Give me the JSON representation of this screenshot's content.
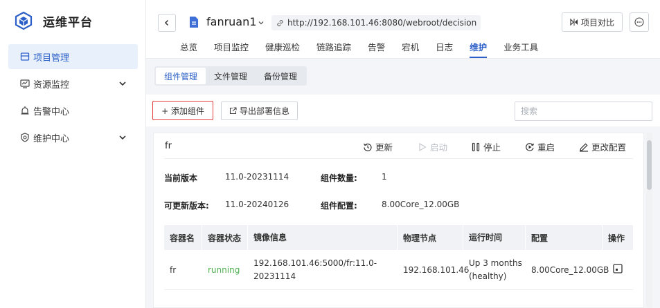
{
  "brand": {
    "title": "运维平台"
  },
  "sidebar": {
    "items": [
      {
        "label": "项目管理",
        "icon": "list-icon",
        "active": true
      },
      {
        "label": "资源监控",
        "icon": "monitor-icon",
        "expandable": true
      },
      {
        "label": "告警中心",
        "icon": "alarm-icon"
      },
      {
        "label": "维护中心",
        "icon": "shield-icon",
        "expandable": true
      }
    ]
  },
  "header": {
    "project_name": "fanruan1",
    "url": "http://192.168.101.46:8080/webroot/decision",
    "compare_label": "项目对比",
    "tabs": [
      "总览",
      "项目监控",
      "健康巡检",
      "链路追踪",
      "告警",
      "宕机",
      "日志",
      "维护",
      "业务工具"
    ],
    "active_tab": "维护"
  },
  "subtabs": {
    "items": [
      "组件管理",
      "文件管理",
      "备份管理"
    ],
    "active": "组件管理"
  },
  "toolbar": {
    "add_label": "+ 添加组件",
    "export_label": "导出部署信息",
    "search_placeholder": "搜索"
  },
  "component": {
    "name": "fr",
    "actions": {
      "update": "更新",
      "start": "启动",
      "stop": "停止",
      "restart": "重启",
      "config": "更改配置"
    },
    "info": {
      "current_version_label": "当前版本",
      "current_version": "11.0-20231114",
      "count_label": "组件数量:",
      "count": "1",
      "updatable_label": "可更新版本:",
      "updatable_version": "11.0-20240126",
      "config_label": "组件配置:",
      "config": "8.00Core_12.00GB"
    },
    "table": {
      "headers": [
        "容器名",
        "容器状态",
        "镜像信息",
        "物理节点",
        "运行时间",
        "配置",
        "操作"
      ],
      "rows": [
        {
          "name": "fr",
          "status": "running",
          "image_line1": "192.168.101.46:5000/fr:11.0-",
          "image_line2": "20231114",
          "node": "192.168.101.46",
          "uptime_line1": "Up 3 months",
          "uptime_line2": "(healthy)",
          "config": "8.00Core_12.00GB"
        }
      ]
    }
  },
  "colors": {
    "accent": "#2c60c8",
    "running": "#4caf50",
    "highlight_border": "#e23c3c"
  }
}
